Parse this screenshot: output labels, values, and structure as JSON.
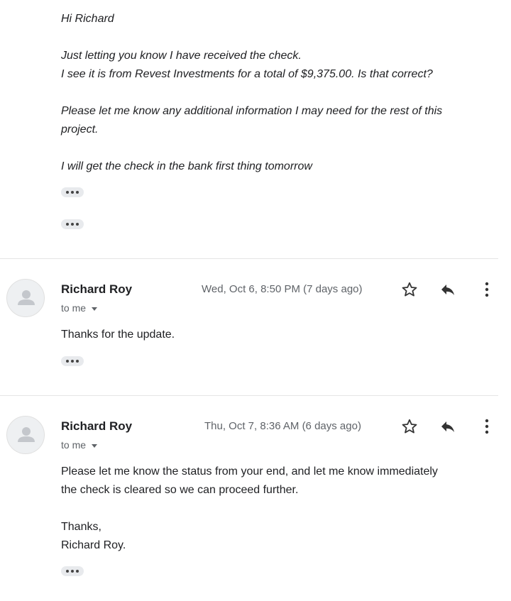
{
  "first_message": {
    "greeting": "Hi Richard",
    "line1": "Just letting you know I have received the check.",
    "line2": "I see it is from Revest Investments for a total of $9,375.00.  Is that correct?",
    "line3a": "Please let me know any additional information I may need for the rest of this",
    "line3b": "project.",
    "line4": "I will get the check in the bank first thing tomorrow"
  },
  "messages": [
    {
      "sender": "Richard Roy",
      "date": "Wed, Oct 6, 8:50 PM (7 days ago)",
      "to_label": "to me",
      "body": [
        "Thanks for the update."
      ]
    },
    {
      "sender": "Richard Roy",
      "date": "Thu, Oct 7, 8:36 AM (6 days ago)",
      "to_label": "to me",
      "body": [
        "Please let me know the status from your end, and let me know immediately",
        "the check is cleared so we can proceed further.",
        "",
        "Thanks,",
        "Richard Roy."
      ]
    }
  ],
  "icons": {
    "star": "star-icon",
    "reply": "reply-icon",
    "more": "more-vertical-icon",
    "avatar": "default-avatar-icon",
    "trimmed": "show-trimmed-content-icon"
  }
}
